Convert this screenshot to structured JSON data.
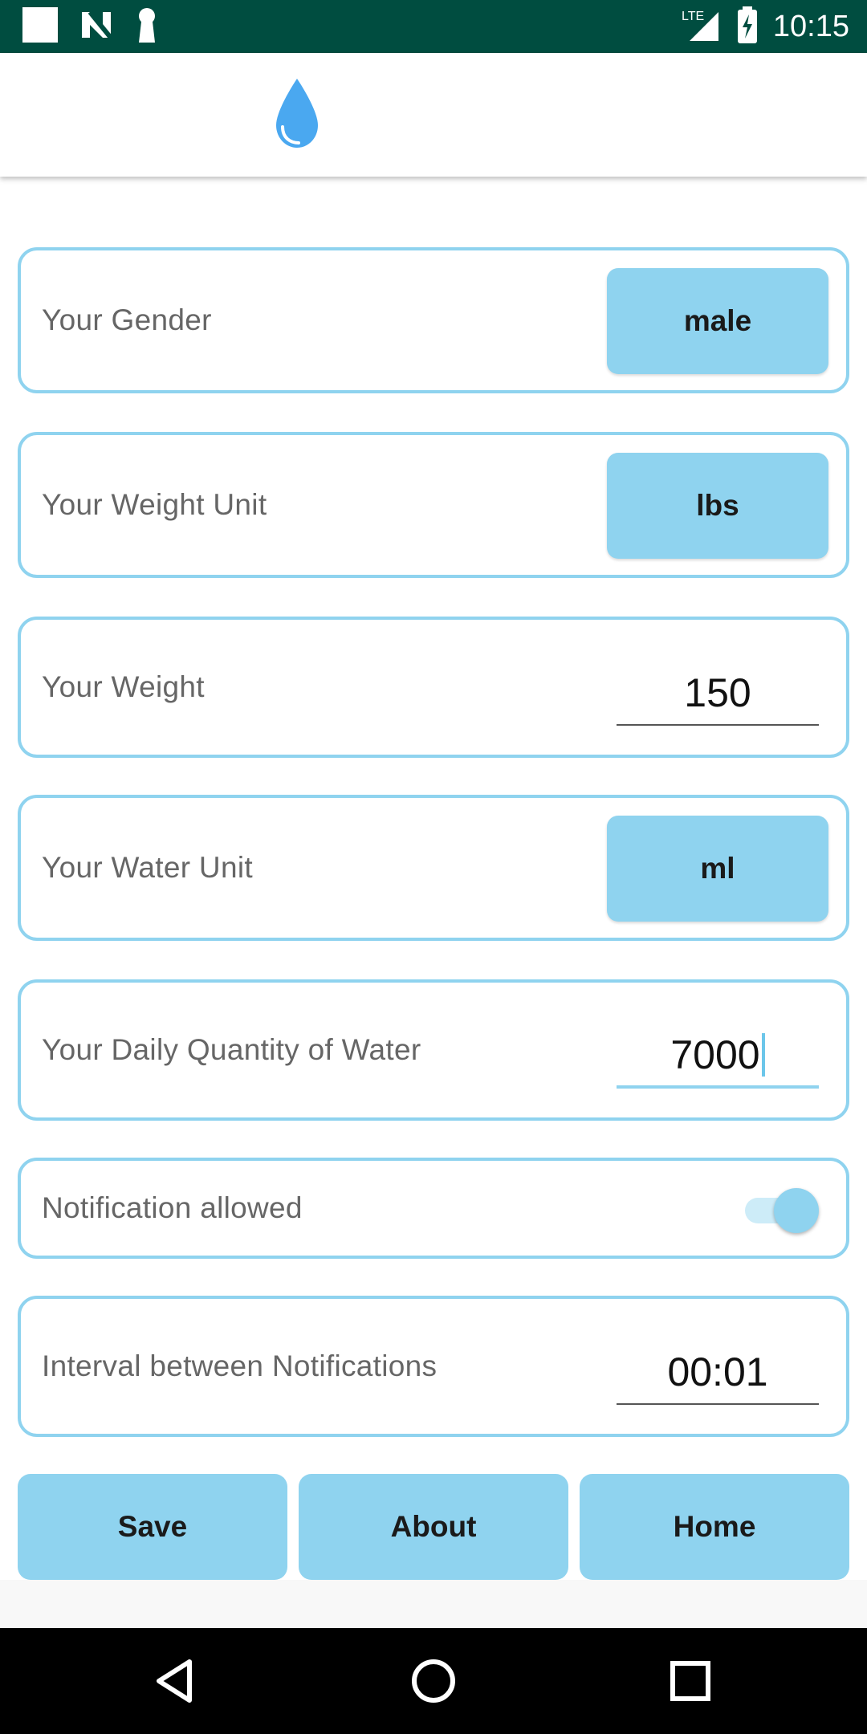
{
  "status_bar": {
    "time": "10:15",
    "network": "LTE",
    "icons": [
      "notification-square-icon",
      "n-logo-icon",
      "keyhole-icon",
      "signal-icon",
      "battery-icon"
    ]
  },
  "app_bar": {
    "icon": "water-drop-icon",
    "accent_color": "#4aa8f0"
  },
  "settings": {
    "gender": {
      "label": "Your Gender",
      "value": "male"
    },
    "weight_unit": {
      "label": "Your Weight Unit",
      "value": "lbs"
    },
    "weight": {
      "label": "Your Weight",
      "value": "150"
    },
    "water_unit": {
      "label": "Your Water Unit",
      "value": "ml"
    },
    "daily_quantity": {
      "label": "Your Daily Quantity of Water",
      "value": "7000"
    },
    "notification": {
      "label": "Notification allowed",
      "enabled": true
    },
    "interval": {
      "label": "Interval between Notifications",
      "value": "00:01"
    }
  },
  "actions": {
    "save": "Save",
    "about": "About",
    "home": "Home"
  },
  "colors": {
    "status_bar": "#004d40",
    "accent": "#8fd3ef",
    "label_text": "#666666"
  },
  "nav_bar": {
    "icons": [
      "back-icon",
      "home-icon",
      "recents-icon"
    ]
  }
}
